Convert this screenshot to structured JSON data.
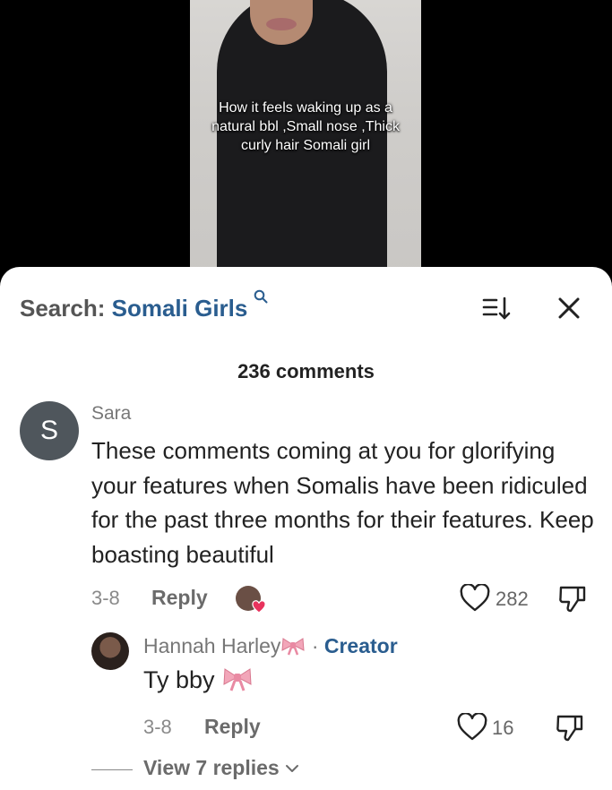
{
  "video": {
    "caption_lines": [
      "How it feels waking up as a",
      "natural bbl ,Small nose ,Thick",
      "curly hair Somali girl"
    ]
  },
  "header": {
    "search_prefix": "Search:",
    "search_term": "Somali Girls",
    "search_icon": "search-icon",
    "sort_icon": "sort-icon",
    "close_icon": "close-icon"
  },
  "comments_count": "236 comments",
  "comment": {
    "avatar_letter": "S",
    "username": "Sara",
    "text": "These comments coming at you for glorifying your features when Somalis have been ridiculed for the past three months for their features. Keep boasting beautiful",
    "date": "3-8",
    "reply_label": "Reply",
    "likes": "282"
  },
  "reply": {
    "username": "Hannah Harley",
    "separator": "·",
    "badge": "Creator",
    "text": "Ty bby",
    "date": "3-8",
    "reply_label": "Reply",
    "likes": "16"
  },
  "view_replies": "View 7 replies",
  "colors": {
    "accent": "#2a5d8f",
    "avatar_bg": "#4f565c",
    "heart": "#e8335d",
    "bow": "#f2a6b9"
  }
}
